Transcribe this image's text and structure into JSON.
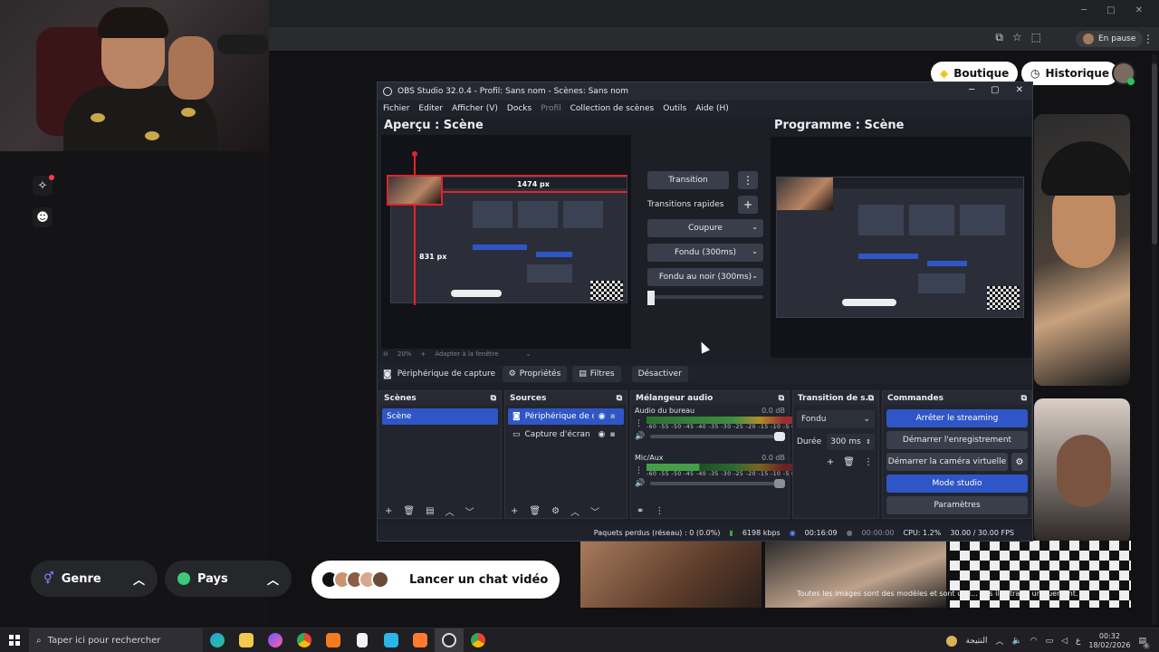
{
  "browser": {
    "pause_label": "En pause"
  },
  "site": {
    "genre_label": "Genre",
    "pays_label": "Pays",
    "launch_label": "Lancer un chat vidéo",
    "shop_label": "Boutique",
    "history_label": "Historique",
    "disclaimer": "Toutes les images sont des modèles et sont utili... fins illustrat... uniquement."
  },
  "obs": {
    "title": "OBS Studio 32.0.4 - Profil: Sans nom - Scènes: Sans nom",
    "menu": [
      "Fichier",
      "Editer",
      "Afficher (V)",
      "Docks",
      "Profil",
      "Collection de scènes",
      "Outils",
      "Aide (H)"
    ],
    "preview_label": "Aperçu : Scène",
    "program_label": "Programme : Scène",
    "width_readout": "1474 px",
    "height_readout": "831 px",
    "zoom_label": "20%",
    "fit_label": "Adapter à la fenêtre",
    "transition_btn": "Transition",
    "quick_transitions_label": "Transitions rapides",
    "quick_transitions": [
      "Coupure",
      "Fondu (300ms)",
      "Fondu au noir (300ms)"
    ],
    "source_bar": {
      "source_name": "Périphérique de capture vic",
      "properties": "Propriétés",
      "filters": "Filtres",
      "deactivate": "Désactiver"
    },
    "scenes": {
      "title": "Scènes",
      "items": [
        "Scène"
      ]
    },
    "sources": {
      "title": "Sources",
      "items": [
        "Périphérique de ca",
        "Capture d'écran"
      ]
    },
    "mixer": {
      "title": "Mélangeur audio",
      "ticks": "-60 -55 -50 -45 -40 -35 -30 -25 -20 -15 -10 -5 0",
      "channels": [
        {
          "name": "Audio du bureau",
          "db": "0.0 dB"
        },
        {
          "name": "Mic/Aux",
          "db": "0.0 dB"
        }
      ]
    },
    "transition_dock": {
      "title": "Transition de s...",
      "type": "Fondu",
      "duration_label": "Durée",
      "duration_value": "300 ms"
    },
    "commands": {
      "title": "Commandes",
      "buttons": [
        "Arrêter le streaming",
        "Démarrer l'enregistrement",
        "Démarrer la caméra virtuelle",
        "Mode studio",
        "Paramètres"
      ]
    },
    "status": {
      "dropped": "Paquets perdus (réseau) : 0 (0.0%)",
      "bitrate": "6198 kbps",
      "stream_time": "00:16:09",
      "rec_time": "00:00:00",
      "cpu": "CPU: 1.2%",
      "fps": "30.00 / 30.00 FPS"
    }
  },
  "taskbar": {
    "search_placeholder": "Taper ici pour rechercher",
    "weather_label": "النتيجة",
    "lang": "ع",
    "time": "00:32",
    "date": "18/02/2026",
    "notif_count": "6"
  },
  "colors": {
    "accent_blue": "#2f56c6",
    "obs_bg": "#1d1f26",
    "selection_red": "#e0242c"
  }
}
